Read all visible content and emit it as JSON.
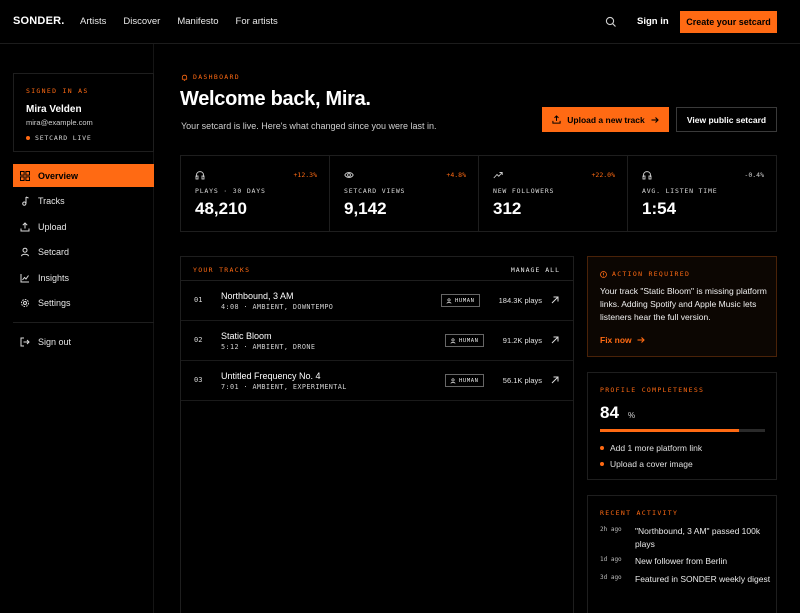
{
  "nav": {
    "logo": "SONDER.",
    "links": [
      "Artists",
      "Discover",
      "Manifesto",
      "For artists"
    ],
    "sign_in": "Sign in",
    "cta": "Create your setcard"
  },
  "user": {
    "eyebrow": "SIGNED IN AS",
    "name": "Mira Velden",
    "email": "mira@example.com",
    "status": "SETCARD LIVE"
  },
  "sidebar": {
    "items": [
      {
        "label": "Overview",
        "icon": "grid-icon",
        "active": true
      },
      {
        "label": "Tracks",
        "icon": "music-note-icon"
      },
      {
        "label": "Upload",
        "icon": "upload-icon"
      },
      {
        "label": "Setcard",
        "icon": "user-icon"
      },
      {
        "label": "Insights",
        "icon": "chart-icon"
      },
      {
        "label": "Settings",
        "icon": "gear-icon"
      }
    ],
    "sign_out": "Sign out"
  },
  "header": {
    "eyebrow": "DASHBOARD",
    "title": "Welcome back, Mira.",
    "subtitle": "Your setcard is live. Here's what changed since you were last in.",
    "upload_button": "Upload a new track",
    "view_button": "View public setcard"
  },
  "stats": [
    {
      "icon": "headphones-icon",
      "delta": "+12.3%",
      "label": "PLAYS · 30 DAYS",
      "value": "48,210"
    },
    {
      "icon": "eye-icon",
      "delta": "+4.8%",
      "label": "SETCARD VIEWS",
      "value": "9,142"
    },
    {
      "icon": "trend-up-icon",
      "delta": "+22.0%",
      "label": "NEW FOLLOWERS",
      "value": "312"
    },
    {
      "icon": "headphones-icon",
      "delta": "-0.4%",
      "label": "AVG. LISTEN TIME",
      "value": "1:54"
    }
  ],
  "tracks": {
    "title": "YOUR TRACKS",
    "manage": "MANAGE ALL",
    "rows": [
      {
        "num": "01",
        "title": "Northbound, 3 AM",
        "meta": "4:08 · AMBIENT, DOWNTEMPO",
        "badge": "HUMAN",
        "plays": "184.3K plays"
      },
      {
        "num": "02",
        "title": "Static Bloom",
        "meta": "5:12 · AMBIENT, DRONE",
        "badge": "HUMAN",
        "plays": "91.2K plays"
      },
      {
        "num": "03",
        "title": "Untitled Frequency No. 4",
        "meta": "7:01 · AMBIENT, EXPERIMENTAL",
        "badge": "HUMAN",
        "plays": "56.1K plays"
      }
    ]
  },
  "action": {
    "eyebrow": "ACTION REQUIRED",
    "text": "Your track \"Static Bloom\" is missing platform links. Adding Spotify and Apple Music lets listeners hear the full version.",
    "link": "Fix now"
  },
  "profile": {
    "eyebrow": "PROFILE COMPLETENESS",
    "value": "84",
    "unit": "%",
    "fill_percent": 84,
    "tips": [
      "Add 1 more platform link",
      "Upload a cover image"
    ]
  },
  "activity": {
    "eyebrow": "RECENT ACTIVITY",
    "items": [
      {
        "time": "2h ago",
        "text": "\"Northbound, 3 AM\" passed 100k plays"
      },
      {
        "time": "1d ago",
        "text": "New follower from Berlin"
      },
      {
        "time": "3d ago",
        "text": "Featured in SONDER weekly digest"
      }
    ]
  },
  "colors": {
    "accent": "#ff6a13",
    "background": "#000000",
    "border": "#1e1e1e"
  }
}
